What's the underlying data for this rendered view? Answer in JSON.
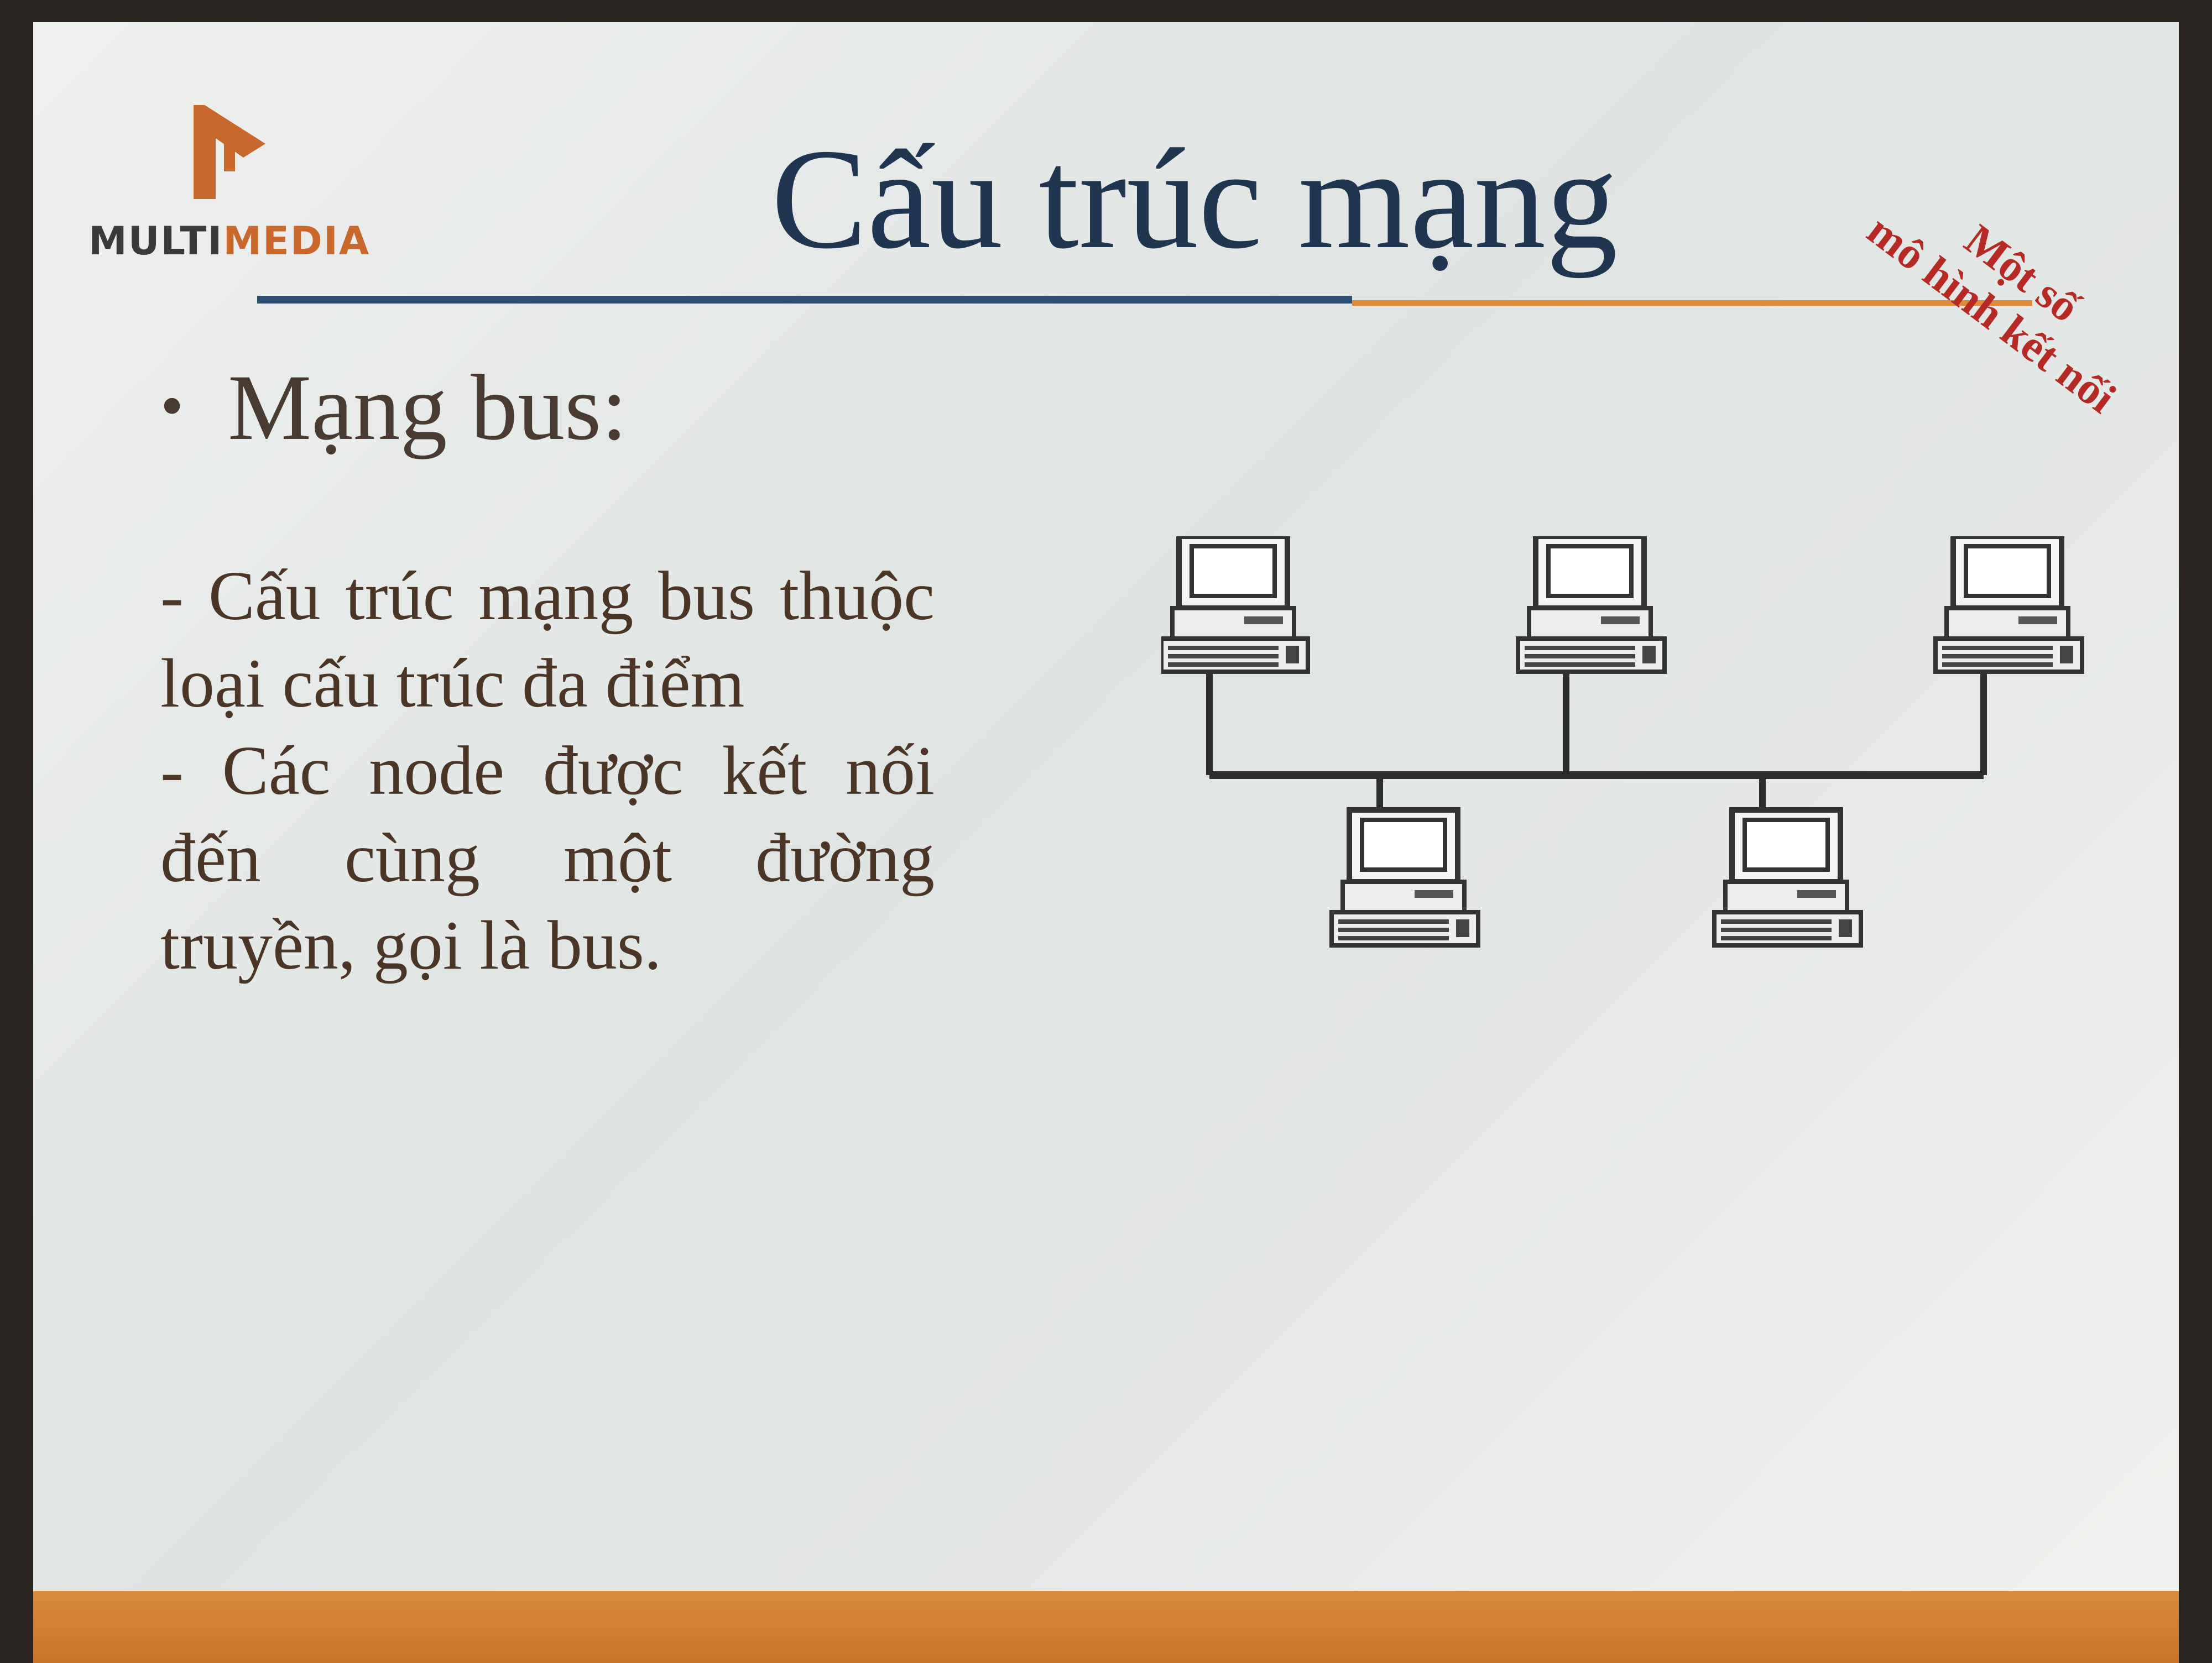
{
  "logo": {
    "text_main": "MULTI",
    "text_accent": "MEDIA"
  },
  "title": "Cấu trúc mạng",
  "stamp": {
    "line1": "Một số",
    "line2": "mô hình kết nối"
  },
  "bullet": {
    "heading": "Mạng bus:"
  },
  "body": {
    "para1": "- Cấu trúc mạng bus thuộc loại cấu trúc đa điểm",
    "para2": "- Các node được kết nối đến cùng một đường truyền, gọi là bus."
  },
  "colors": {
    "title": "#1f3550",
    "accent": "#e08a3a",
    "stamp": "#b52a25",
    "rule": "#2e4f73"
  },
  "diagram": {
    "type": "bus-topology",
    "nodes": 5,
    "icon": "computer-icon"
  }
}
